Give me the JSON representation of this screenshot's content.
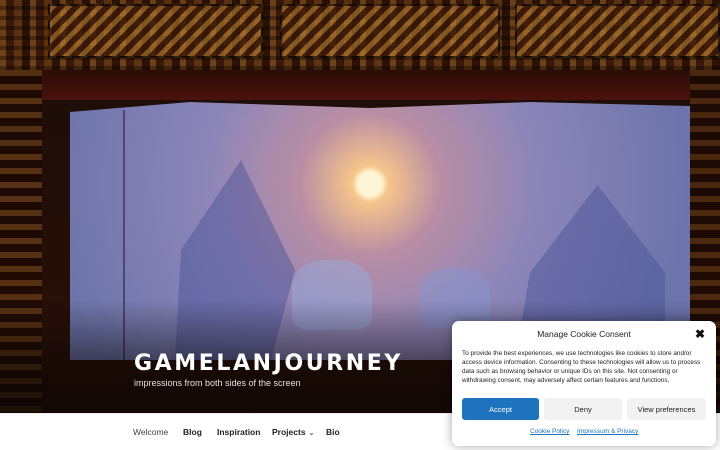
{
  "site": {
    "title": "GAMELANJOURNEY",
    "tagline": "impressions from both sides of the screen"
  },
  "nav": {
    "items": [
      {
        "label": "Welcome"
      },
      {
        "label": "Blog"
      },
      {
        "label": "Inspiration"
      },
      {
        "label": "Projects",
        "dropdown_icon": "chevron-down-icon"
      },
      {
        "label": "Bio"
      }
    ]
  },
  "cookie": {
    "title": "Manage Cookie Consent",
    "close_icon": "close-icon",
    "body": "To provide the best experiences, we use technologies like cookies to store and/or access device information. Consenting to these technologies will allow us to process data such as browsing behavior or unique IDs on this site. Not consenting or withdrawing consent, may adversely affect certain features and functions.",
    "accept_label": "Accept",
    "deny_label": "Deny",
    "preferences_label": "View preferences",
    "cookie_policy_label": "Cookie Policy",
    "impressum_label": "Impressum & Privacy",
    "accent_color": "#1e73be"
  }
}
